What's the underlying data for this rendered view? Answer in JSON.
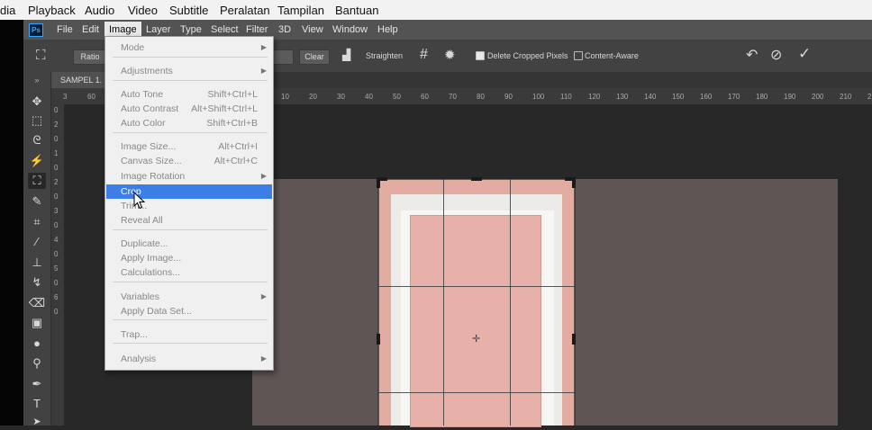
{
  "player_menu": [
    "dia",
    "Playback",
    "Audio",
    "Video",
    "Subtitle",
    "Peralatan",
    "Tampilan",
    "Bantuan"
  ],
  "ps": {
    "logo": "Ps",
    "menus": [
      "File",
      "Edit",
      "Image",
      "Layer",
      "Type",
      "Select",
      "Filter",
      "3D",
      "View",
      "Window",
      "Help"
    ]
  },
  "options": {
    "ratio": "Ratio",
    "clear": "Clear",
    "straighten": "Straighten",
    "delete_cropped": "Delete Cropped Pixels",
    "delete_cropped_checked": true,
    "content_aware": "Content-Aware",
    "content_aware_checked": false,
    "icons": [
      "crop-icon",
      "straighten-icon",
      "grid-overlay-icon",
      "gear-icon",
      "reset-icon",
      "cancel-icon",
      "commit-check-icon"
    ]
  },
  "document": {
    "tab": "SAMPEL 1.",
    "ruler_h": [
      "3",
      "60",
      "10",
      "20",
      "30",
      "40",
      "50",
      "60",
      "70",
      "80",
      "90",
      "100",
      "110",
      "120",
      "130",
      "140",
      "150",
      "160",
      "170",
      "180",
      "190",
      "200",
      "210",
      "220"
    ],
    "ruler_v": [
      "0",
      "2",
      "0",
      "1",
      "0",
      "2",
      "0",
      "3",
      "0",
      "4",
      "0",
      "5",
      "0",
      "6",
      "0"
    ]
  },
  "image_menu": {
    "items": [
      {
        "label": "Mode",
        "shortcut": "",
        "submenu": true
      },
      {
        "label": "Adjustments",
        "shortcut": "",
        "submenu": true
      },
      {
        "label": "Auto Tone",
        "shortcut": "Shift+Ctrl+L",
        "submenu": false
      },
      {
        "label": "Auto Contrast",
        "shortcut": "Alt+Shift+Ctrl+L",
        "submenu": false
      },
      {
        "label": "Auto Color",
        "shortcut": "Shift+Ctrl+B",
        "submenu": false
      },
      {
        "label": "Image Size...",
        "shortcut": "Alt+Ctrl+I",
        "submenu": false
      },
      {
        "label": "Canvas Size...",
        "shortcut": "Alt+Ctrl+C",
        "submenu": false
      },
      {
        "label": "Image Rotation",
        "shortcut": "",
        "submenu": true
      },
      {
        "label": "Crop",
        "shortcut": "",
        "submenu": false,
        "highlighted": true
      },
      {
        "label": "Trim...",
        "shortcut": "",
        "submenu": false
      },
      {
        "label": "Reveal All",
        "shortcut": "",
        "submenu": false
      },
      {
        "label": "Duplicate...",
        "shortcut": "",
        "submenu": false
      },
      {
        "label": "Apply Image...",
        "shortcut": "",
        "submenu": false
      },
      {
        "label": "Calculations...",
        "shortcut": "",
        "submenu": false
      },
      {
        "label": "Variables",
        "shortcut": "",
        "submenu": true
      },
      {
        "label": "Apply Data Set...",
        "shortcut": "",
        "submenu": false
      },
      {
        "label": "Trap...",
        "shortcut": "",
        "submenu": false
      },
      {
        "label": "Analysis",
        "shortcut": "",
        "submenu": true
      }
    ]
  },
  "colors": {
    "highlight": "#3d7ee6",
    "ps_bg": "#535353",
    "door": "#e2aca3"
  }
}
